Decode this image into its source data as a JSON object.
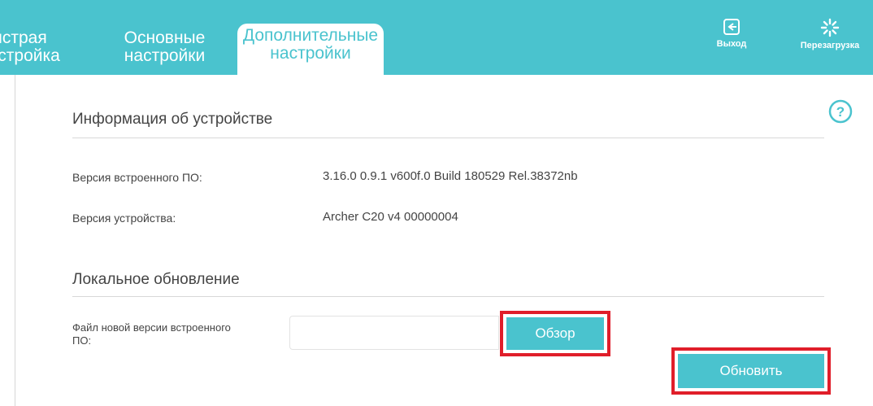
{
  "header": {
    "tabs": [
      {
        "line1": "Быстрая",
        "line2": "настройка"
      },
      {
        "line1": "Основные",
        "line2": "настройки"
      },
      {
        "line1": "Дополнительные",
        "line2": "настройки"
      }
    ],
    "logout_label": "Выход",
    "reboot_label": "Перезагрузка"
  },
  "device_info": {
    "title": "Информация об устройстве",
    "firmware_label": "Версия встроенного ПО:",
    "firmware_value": "3.16.0 0.9.1 v600f.0 Build 180529 Rel.38372nb",
    "hardware_label": "Версия устройства:",
    "hardware_value": "Archer C20 v4 00000004"
  },
  "local_update": {
    "title": "Локальное обновление",
    "file_label_line1": "Файл новой версии встроенного",
    "file_label_line2": "ПО:",
    "file_value": "",
    "browse_label": "Обзор",
    "update_label": "Обновить"
  },
  "colors": {
    "accent": "#4ac3ce",
    "highlight": "#e01e2a"
  }
}
